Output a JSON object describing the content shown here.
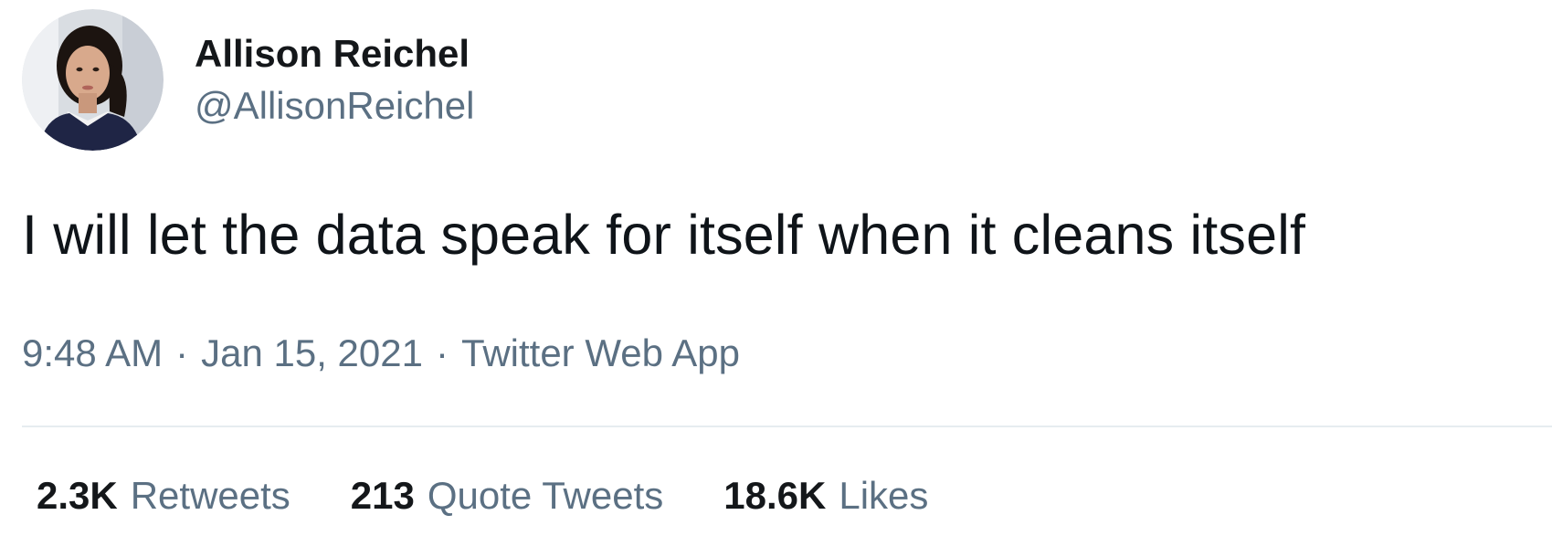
{
  "author": {
    "display_name": "Allison Reichel",
    "handle": "@AllisonReichel"
  },
  "tweet": {
    "text": "I will let the data speak for itself when it cleans itself",
    "time": "9:48 AM",
    "date": "Jan 15, 2021",
    "source": "Twitter Web App",
    "separator": "·"
  },
  "stats": [
    {
      "count": "2.3K",
      "label": "Retweets"
    },
    {
      "count": "213",
      "label": "Quote Tweets"
    },
    {
      "count": "18.6K",
      "label": "Likes"
    }
  ],
  "colors": {
    "primary_text": "#14171a",
    "secondary_text": "#5b7083",
    "divider": "#e6ecf0"
  }
}
